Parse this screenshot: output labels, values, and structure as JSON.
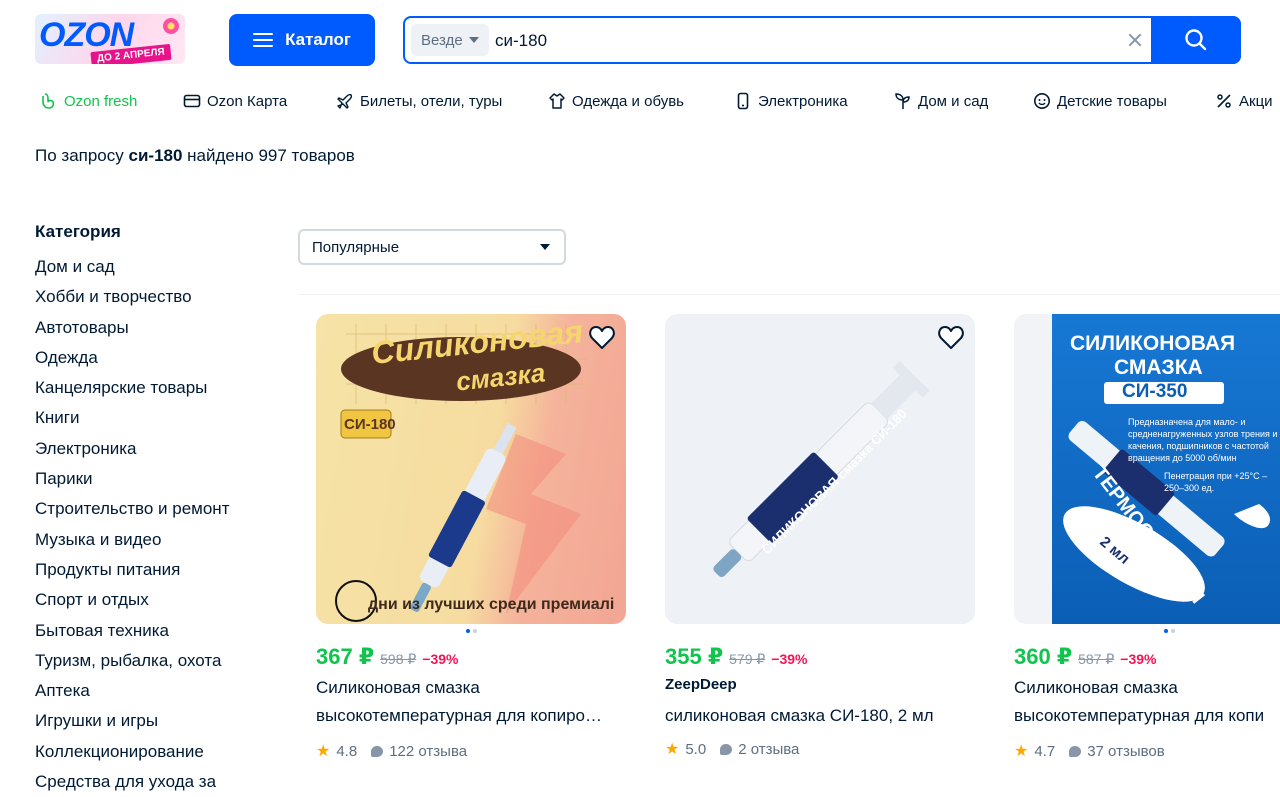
{
  "header": {
    "logo_text": "OZON",
    "logo_badge": "ДО 2 АПРЕЛЯ",
    "catalog_label": "Каталог",
    "search_scope": "Везде",
    "search_value": "си-180"
  },
  "nav": [
    {
      "label": "Ozon fresh",
      "icon": "fresh-icon"
    },
    {
      "label": "Ozon Карта",
      "icon": "card-icon"
    },
    {
      "label": "Билеты, отели, туры",
      "icon": "plane-icon"
    },
    {
      "label": "Одежда и обувь",
      "icon": "clothes-icon"
    },
    {
      "label": "Электроника",
      "icon": "phone-icon"
    },
    {
      "label": "Дом и сад",
      "icon": "plant-icon"
    },
    {
      "label": "Детские товары",
      "icon": "baby-icon"
    },
    {
      "label": "Акци",
      "icon": "percent-icon"
    }
  ],
  "result": {
    "prefix": "По запросу",
    "query": "си-180",
    "suffix": "найдено 997 товаров"
  },
  "sidebar": {
    "title": "Категория",
    "items": [
      "Дом и сад",
      "Хобби и творчество",
      "Автотовары",
      "Одежда",
      "Канцелярские товары",
      "Книги",
      "Электроника",
      "Парики",
      "Строительство и ремонт",
      "Музыка и видео",
      "Продукты питания",
      "Спорт и отдых",
      "Бытовая техника",
      "Туризм, рыбалка, охота",
      "Аптека",
      "Игрушки и игры",
      "Коллекционирование",
      "Средства для ухода за"
    ]
  },
  "sort": {
    "selected": "Популярные"
  },
  "products": [
    {
      "price": "367 ₽",
      "old_price": "598 ₽",
      "discount": "−39%",
      "brand": "",
      "title_line1": "Силиконовая смазка",
      "title_line2": "высокотемпературная для копиро…",
      "rating": "4.8",
      "reviews": "122 отзыва",
      "image_text": {
        "headline1": "Силиконовая",
        "headline2": "смазка",
        "tag": "СИ-180",
        "caption": "дни из лучших среди премиалі"
      }
    },
    {
      "price": "355 ₽",
      "old_price": "579 ₽",
      "discount": "−39%",
      "brand": "ZeepDeep",
      "title_line1": "силиконовая смазка СИ-180, 2 мл",
      "title_line2": "",
      "rating": "5.0",
      "reviews": "2 отзыва",
      "image_text": {
        "label": "СИЛИКОНОВАЯ смазка СИ-180"
      }
    },
    {
      "price": "360 ₽",
      "old_price": "587 ₽",
      "discount": "−39%",
      "brand": "",
      "title_line1": "Силиконовая смазка",
      "title_line2": "высокотемпературная для копи",
      "rating": "4.7",
      "reviews": "37 отзывов",
      "image_text": {
        "headline1": "СИЛИКОНОВАЯ",
        "headline2": "СМАЗКА",
        "tag": "СИ-350",
        "desc": "Предназначена для мало- и средненагруженных узлов трения и качения, подшипников с частотой вращения до 5000 об/мин",
        "desc2": "Пенетрация при +25°С – 250–300 ед.",
        "side": "ТЕРМОСТОЙКАЯ",
        "volume": "2 мл"
      }
    }
  ],
  "colors": {
    "brand": "#005bff",
    "price": "#10c44c",
    "discount": "#f91155",
    "rating_star": "#ffa800"
  }
}
